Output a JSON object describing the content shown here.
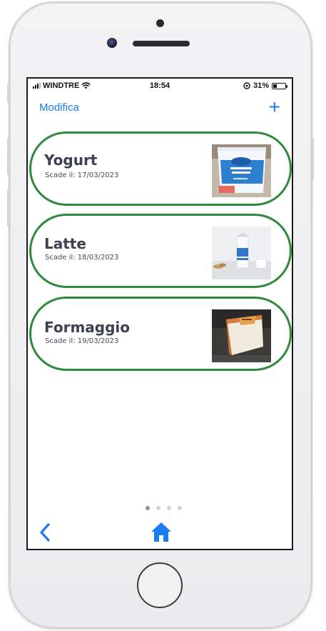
{
  "status_bar": {
    "carrier": "WINDTRE",
    "time": "18:54",
    "battery": "31%",
    "battery_level": 0.31
  },
  "nav": {
    "edit_label": "Modifica",
    "add_label": "+"
  },
  "items": [
    {
      "name": "Yogurt",
      "expiry": "Scade il: 17/03/2023",
      "image": "yogurt-cup-photo"
    },
    {
      "name": "Latte",
      "expiry": "Scade il: 18/03/2023",
      "image": "milk-carton-photo"
    },
    {
      "name": "Formaggio",
      "expiry": "Scade il: 19/03/2023",
      "image": "cheese-wedge-photo"
    }
  ],
  "pager": {
    "pages": 4,
    "current": 1
  },
  "toolbar": {
    "back_icon": "chevron-left-icon",
    "home_icon": "home-icon"
  },
  "colors": {
    "accent": "#1a7cf0",
    "card_border": "#2e8b3e",
    "title_text": "#3b4150"
  }
}
